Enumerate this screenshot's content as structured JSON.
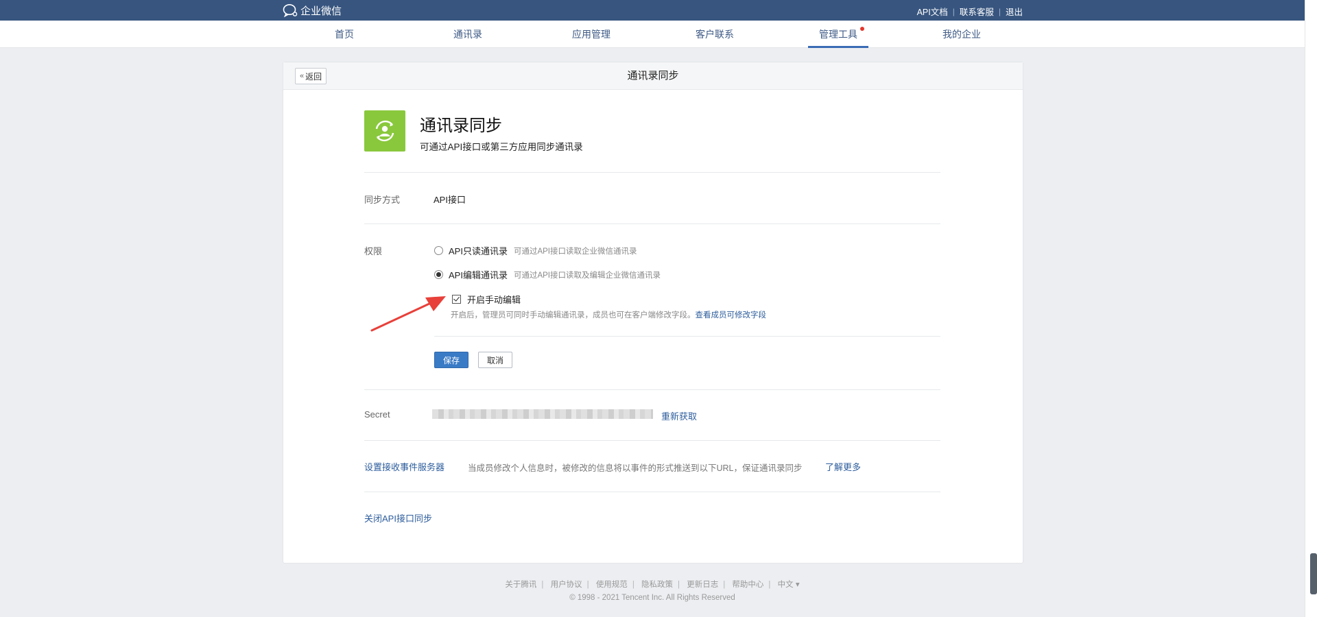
{
  "header": {
    "logo_text": "企业微信",
    "links": [
      "API文档",
      "联系客服",
      "退出"
    ]
  },
  "nav": {
    "items": [
      "首页",
      "通讯录",
      "应用管理",
      "客户联系",
      "管理工具",
      "我的企业"
    ],
    "active": "管理工具"
  },
  "page": {
    "back_label": "返回",
    "title": "通讯录同步"
  },
  "app": {
    "name": "通讯录同步",
    "desc": "可通过API接口或第三方应用同步通讯录"
  },
  "sync": {
    "label": "同步方式",
    "value": "API接口"
  },
  "permission": {
    "label": "权限",
    "options": [
      {
        "label": "API只读通讯录",
        "hint": "可通过API接口读取企业微信通讯录",
        "checked": false
      },
      {
        "label": "API编辑通讯录",
        "hint": "可通过API接口读取及编辑企业微信通讯录",
        "checked": true
      }
    ],
    "manual_edit_label": "开启手动编辑",
    "manual_edit_hint": "开启后，管理员可同时手动编辑通讯录，成员也可在客户端修改字段。",
    "manual_edit_link": "查看成员可修改字段",
    "save_label": "保存",
    "cancel_label": "取消"
  },
  "secret": {
    "label": "Secret",
    "refresh_label": "重新获取"
  },
  "event_server": {
    "link": "设置接收事件服务器",
    "hint": "当成员修改个人信息时，被修改的信息将以事件的形式推送到以下URL，保证通讯录同步",
    "more": "了解更多"
  },
  "close_sync": "关闭API接口同步",
  "footer": {
    "links": [
      "关于腾讯",
      "用户协议",
      "使用规范",
      "隐私政策",
      "更新日志",
      "帮助中心",
      "中文 ▾"
    ],
    "copyright": "© 1998 - 2021 Tencent Inc. All Rights Reserved"
  },
  "colors": {
    "topbar": "#37557f",
    "app_icon": "#89c83c",
    "primary_button": "#3a7bc6",
    "arrow": "#e8403a"
  }
}
